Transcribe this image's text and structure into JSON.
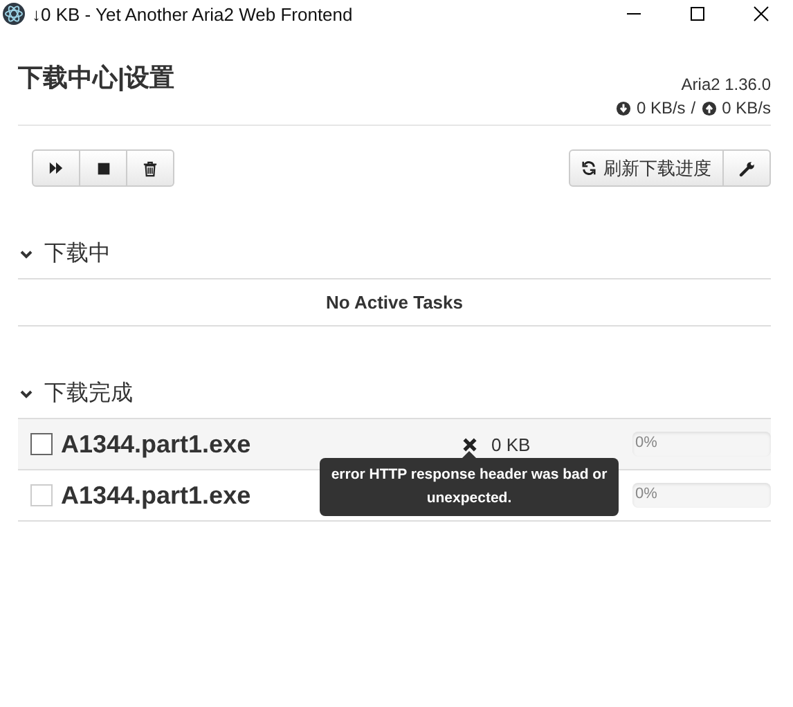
{
  "window": {
    "title": "↓0 KB - Yet Another Aria2 Web Frontend"
  },
  "header": {
    "title": "下载中心|设置",
    "version": "Aria2 1.36.0",
    "download_speed": "0 KB/s",
    "separator": "/",
    "upload_speed": "0 KB/s"
  },
  "toolbar": {
    "refresh_button": "刷新下载进度"
  },
  "sections": [
    {
      "title": "下载中",
      "expanded": true,
      "empty_text": "No Active Tasks"
    },
    {
      "title": "下载完成",
      "expanded": true,
      "tasks": [
        {
          "name": "A1344.part1.exe",
          "checked": false,
          "highlighted": true,
          "size": "0 KB",
          "level": 0,
          "percent": "0%",
          "tooltip": "error HTTP response header was bad or unexpected."
        },
        {
          "name": "A1344.part1.exe",
          "checked": false,
          "highlighted": false,
          "level": 0,
          "percent": "0%"
        }
      ]
    }
  ]
}
